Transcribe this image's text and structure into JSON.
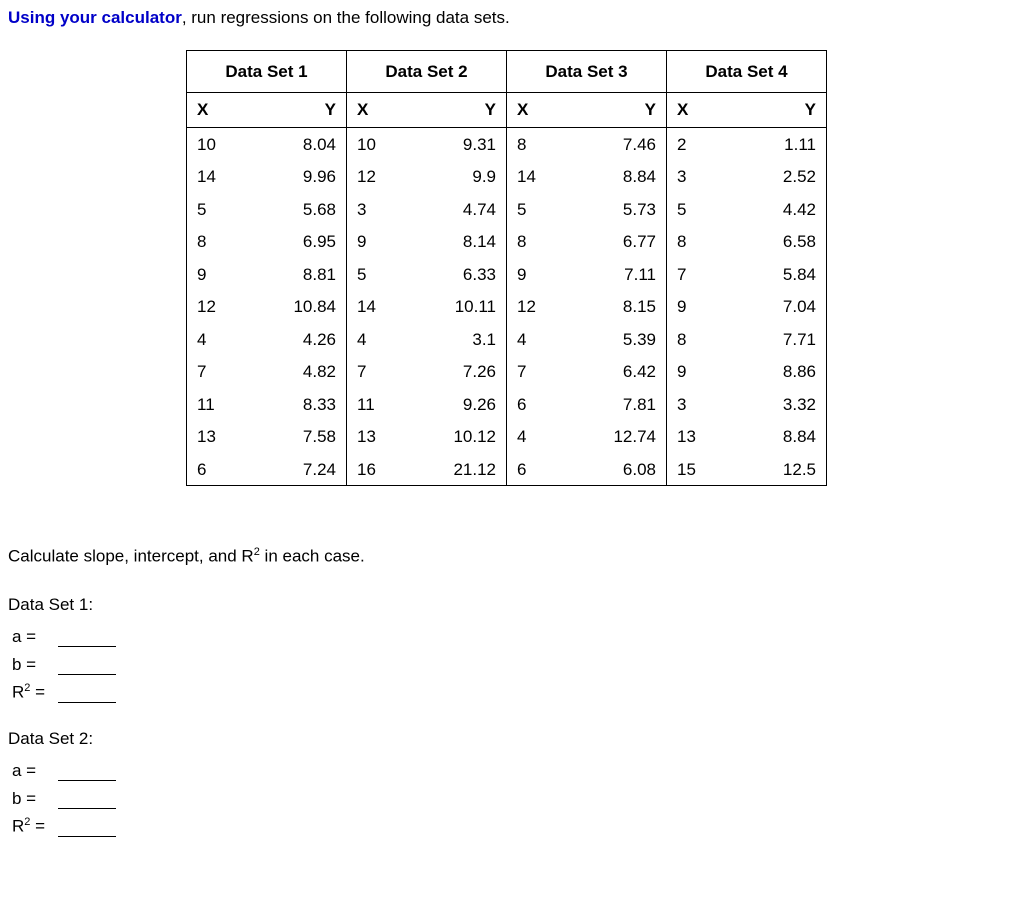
{
  "instruction": {
    "lead": "Using your calculator",
    "rest": ", run regressions on the following data sets."
  },
  "datasets": [
    {
      "title": "Data Set 1",
      "xh": "X",
      "yh": "Y",
      "rows": [
        {
          "x": "10",
          "y": "8.04"
        },
        {
          "x": "14",
          "y": "9.96"
        },
        {
          "x": "5",
          "y": "5.68"
        },
        {
          "x": "8",
          "y": "6.95"
        },
        {
          "x": "9",
          "y": "8.81"
        },
        {
          "x": "12",
          "y": "10.84"
        },
        {
          "x": "4",
          "y": "4.26"
        },
        {
          "x": "7",
          "y": "4.82"
        },
        {
          "x": "11",
          "y": "8.33"
        },
        {
          "x": "13",
          "y": "7.58"
        },
        {
          "x": "6",
          "y": "7.24"
        }
      ]
    },
    {
      "title": "Data Set 2",
      "xh": "X",
      "yh": "Y",
      "rows": [
        {
          "x": "10",
          "y": "9.31"
        },
        {
          "x": "12",
          "y": "9.9"
        },
        {
          "x": "3",
          "y": "4.74"
        },
        {
          "x": "9",
          "y": "8.14"
        },
        {
          "x": "5",
          "y": "6.33"
        },
        {
          "x": "14",
          "y": "10.11"
        },
        {
          "x": "4",
          "y": "3.1"
        },
        {
          "x": "7",
          "y": "7.26"
        },
        {
          "x": "11",
          "y": "9.26"
        },
        {
          "x": "13",
          "y": "10.12"
        },
        {
          "x": "16",
          "y": "21.12"
        }
      ]
    },
    {
      "title": "Data Set 3",
      "xh": "X",
      "yh": "Y",
      "rows": [
        {
          "x": "8",
          "y": "7.46"
        },
        {
          "x": "14",
          "y": "8.84"
        },
        {
          "x": "5",
          "y": "5.73"
        },
        {
          "x": "8",
          "y": "6.77"
        },
        {
          "x": "9",
          "y": "7.11"
        },
        {
          "x": "12",
          "y": "8.15"
        },
        {
          "x": "4",
          "y": "5.39"
        },
        {
          "x": "7",
          "y": "6.42"
        },
        {
          "x": "6",
          "y": "7.81"
        },
        {
          "x": "4",
          "y": "12.74"
        },
        {
          "x": "6",
          "y": "6.08"
        }
      ]
    },
    {
      "title": "Data Set 4",
      "xh": "X",
      "yh": "Y",
      "rows": [
        {
          "x": "2",
          "y": "1.11"
        },
        {
          "x": "3",
          "y": "2.52"
        },
        {
          "x": "5",
          "y": "4.42"
        },
        {
          "x": "8",
          "y": "6.58"
        },
        {
          "x": "7",
          "y": "5.84"
        },
        {
          "x": "9",
          "y": "7.04"
        },
        {
          "x": "8",
          "y": "7.71"
        },
        {
          "x": "9",
          "y": "8.86"
        },
        {
          "x": "3",
          "y": "3.32"
        },
        {
          "x": "13",
          "y": "8.84"
        },
        {
          "x": "15",
          "y": "12.5"
        }
      ]
    }
  ],
  "after": {
    "prompt_pre": "Calculate slope, intercept, and R",
    "prompt_sup": "2",
    "prompt_post": " in each case.",
    "groups": [
      {
        "title": "Data Set 1:",
        "rows": [
          {
            "lbl": "a ="
          },
          {
            "lbl": "b ="
          },
          {
            "lbl_pre": "R",
            "lbl_sup": "2",
            "lbl_post": " ="
          }
        ]
      },
      {
        "title": "Data Set 2:",
        "rows": [
          {
            "lbl": "a ="
          },
          {
            "lbl": "b ="
          },
          {
            "lbl_pre": "R",
            "lbl_sup": "2",
            "lbl_post": " ="
          }
        ]
      }
    ]
  }
}
